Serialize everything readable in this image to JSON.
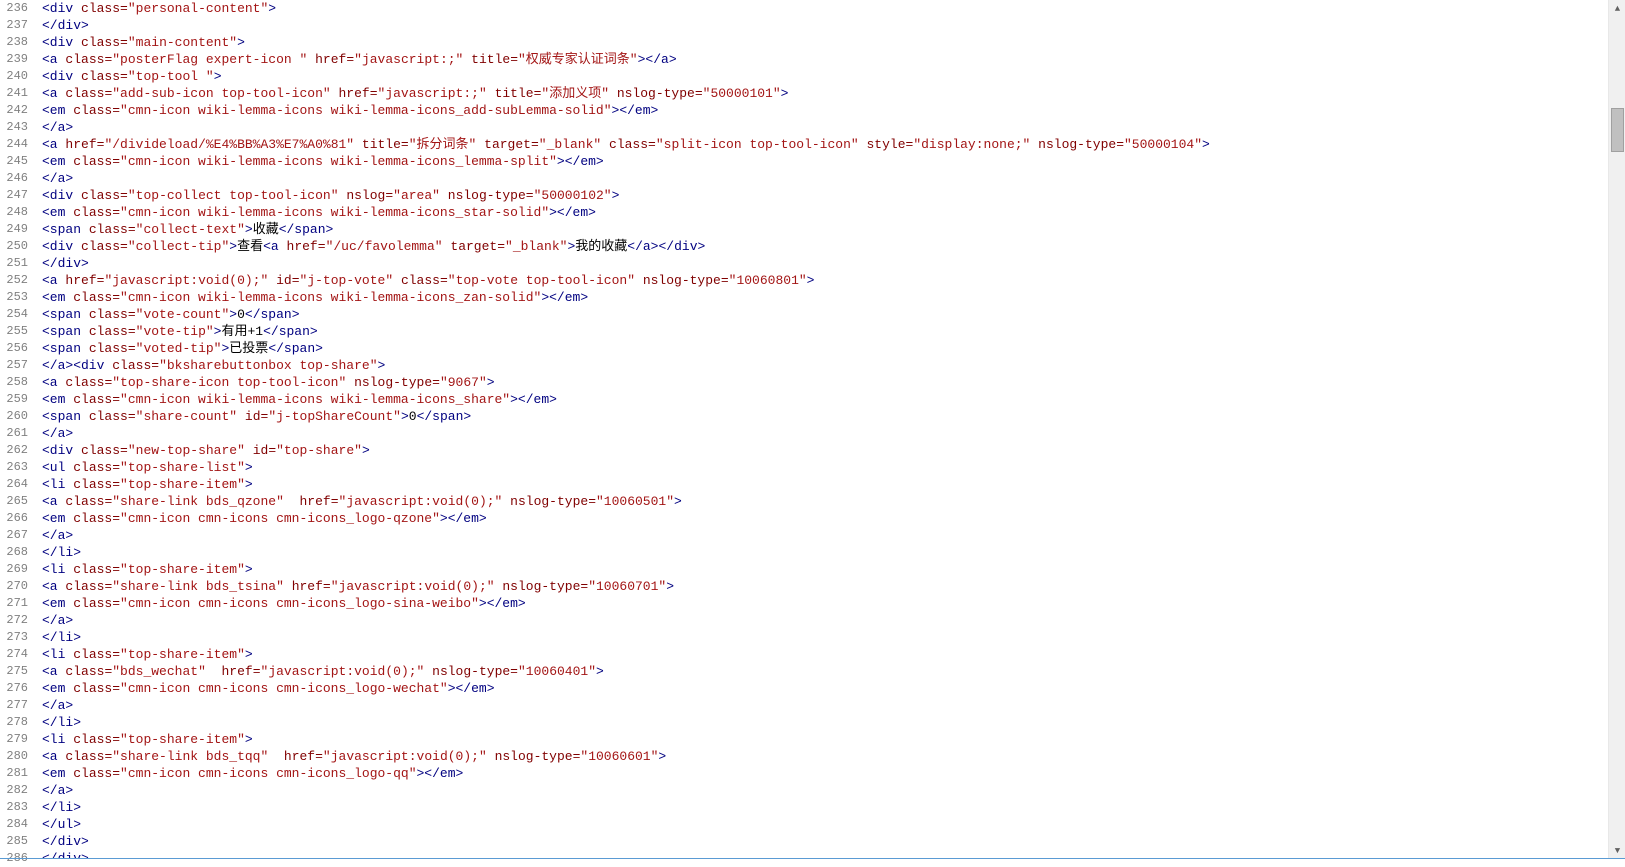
{
  "startLine": 236,
  "lines": [
    [
      [
        "tag",
        "<div"
      ],
      [
        "text",
        " "
      ],
      [
        "attr",
        "class"
      ],
      [
        "punct",
        "="
      ],
      [
        "val",
        "\"personal-content\""
      ],
      [
        "tag",
        ">"
      ]
    ],
    [
      [
        "tag",
        "</div>"
      ]
    ],
    [
      [
        "tag",
        "<div"
      ],
      [
        "text",
        " "
      ],
      [
        "attr",
        "class"
      ],
      [
        "punct",
        "="
      ],
      [
        "val",
        "\"main-content\""
      ],
      [
        "tag",
        ">"
      ]
    ],
    [
      [
        "tag",
        "<a"
      ],
      [
        "text",
        " "
      ],
      [
        "attr",
        "class"
      ],
      [
        "punct",
        "="
      ],
      [
        "val",
        "\"posterFlag expert-icon \""
      ],
      [
        "text",
        " "
      ],
      [
        "attr",
        "href"
      ],
      [
        "punct",
        "="
      ],
      [
        "val",
        "\"javascript:;\""
      ],
      [
        "text",
        " "
      ],
      [
        "attr",
        "title"
      ],
      [
        "punct",
        "="
      ],
      [
        "val",
        "\"权威专家认证词条\""
      ],
      [
        "tag",
        "></a>"
      ]
    ],
    [
      [
        "tag",
        "<div"
      ],
      [
        "text",
        " "
      ],
      [
        "attr",
        "class"
      ],
      [
        "punct",
        "="
      ],
      [
        "val",
        "\"top-tool \""
      ],
      [
        "tag",
        ">"
      ]
    ],
    [
      [
        "tag",
        "<a"
      ],
      [
        "text",
        " "
      ],
      [
        "attr",
        "class"
      ],
      [
        "punct",
        "="
      ],
      [
        "val",
        "\"add-sub-icon top-tool-icon\""
      ],
      [
        "text",
        " "
      ],
      [
        "attr",
        "href"
      ],
      [
        "punct",
        "="
      ],
      [
        "val",
        "\"javascript:;\""
      ],
      [
        "text",
        " "
      ],
      [
        "attr",
        "title"
      ],
      [
        "punct",
        "="
      ],
      [
        "val",
        "\"添加义项\""
      ],
      [
        "text",
        " "
      ],
      [
        "attr",
        "nslog-type"
      ],
      [
        "punct",
        "="
      ],
      [
        "val",
        "\"50000101\""
      ],
      [
        "tag",
        ">"
      ]
    ],
    [
      [
        "tag",
        "<em"
      ],
      [
        "text",
        " "
      ],
      [
        "attr",
        "class"
      ],
      [
        "punct",
        "="
      ],
      [
        "val",
        "\"cmn-icon wiki-lemma-icons wiki-lemma-icons_add-subLemma-solid\""
      ],
      [
        "tag",
        "></em>"
      ]
    ],
    [
      [
        "tag",
        "</a>"
      ]
    ],
    [
      [
        "tag",
        "<a"
      ],
      [
        "text",
        " "
      ],
      [
        "attr",
        "href"
      ],
      [
        "punct",
        "="
      ],
      [
        "val",
        "\"/divideload/%E4%BB%A3%E7%A0%81\""
      ],
      [
        "text",
        " "
      ],
      [
        "attr",
        "title"
      ],
      [
        "punct",
        "="
      ],
      [
        "val",
        "\"拆分词条\""
      ],
      [
        "text",
        " "
      ],
      [
        "attr",
        "target"
      ],
      [
        "punct",
        "="
      ],
      [
        "val",
        "\"_blank\""
      ],
      [
        "text",
        " "
      ],
      [
        "attr",
        "class"
      ],
      [
        "punct",
        "="
      ],
      [
        "val",
        "\"split-icon top-tool-icon\""
      ],
      [
        "text",
        " "
      ],
      [
        "attr",
        "style"
      ],
      [
        "punct",
        "="
      ],
      [
        "val",
        "\"display:none;\""
      ],
      [
        "text",
        " "
      ],
      [
        "attr",
        "nslog-type"
      ],
      [
        "punct",
        "="
      ],
      [
        "val",
        "\"50000104\""
      ],
      [
        "tag",
        ">"
      ]
    ],
    [
      [
        "tag",
        "<em"
      ],
      [
        "text",
        " "
      ],
      [
        "attr",
        "class"
      ],
      [
        "punct",
        "="
      ],
      [
        "val",
        "\"cmn-icon wiki-lemma-icons wiki-lemma-icons_lemma-split\""
      ],
      [
        "tag",
        "></em>"
      ]
    ],
    [
      [
        "tag",
        "</a>"
      ]
    ],
    [
      [
        "tag",
        "<div"
      ],
      [
        "text",
        " "
      ],
      [
        "attr",
        "class"
      ],
      [
        "punct",
        "="
      ],
      [
        "val",
        "\"top-collect top-tool-icon\""
      ],
      [
        "text",
        " "
      ],
      [
        "attr",
        "nslog"
      ],
      [
        "punct",
        "="
      ],
      [
        "val",
        "\"area\""
      ],
      [
        "text",
        " "
      ],
      [
        "attr",
        "nslog-type"
      ],
      [
        "punct",
        "="
      ],
      [
        "val",
        "\"50000102\""
      ],
      [
        "tag",
        ">"
      ]
    ],
    [
      [
        "tag",
        "<em"
      ],
      [
        "text",
        " "
      ],
      [
        "attr",
        "class"
      ],
      [
        "punct",
        "="
      ],
      [
        "val",
        "\"cmn-icon wiki-lemma-icons wiki-lemma-icons_star-solid\""
      ],
      [
        "tag",
        "></em>"
      ]
    ],
    [
      [
        "tag",
        "<span"
      ],
      [
        "text",
        " "
      ],
      [
        "attr",
        "class"
      ],
      [
        "punct",
        "="
      ],
      [
        "val",
        "\"collect-text\""
      ],
      [
        "tag",
        ">"
      ],
      [
        "text",
        "收藏"
      ],
      [
        "tag",
        "</span>"
      ]
    ],
    [
      [
        "tag",
        "<div"
      ],
      [
        "text",
        " "
      ],
      [
        "attr",
        "class"
      ],
      [
        "punct",
        "="
      ],
      [
        "val",
        "\"collect-tip\""
      ],
      [
        "tag",
        ">"
      ],
      [
        "text",
        "查看"
      ],
      [
        "tag",
        "<a"
      ],
      [
        "text",
        " "
      ],
      [
        "attr",
        "href"
      ],
      [
        "punct",
        "="
      ],
      [
        "val",
        "\"/uc/favolemma\""
      ],
      [
        "text",
        " "
      ],
      [
        "attr",
        "target"
      ],
      [
        "punct",
        "="
      ],
      [
        "val",
        "\"_blank\""
      ],
      [
        "tag",
        ">"
      ],
      [
        "text",
        "我的收藏"
      ],
      [
        "tag",
        "</a></div>"
      ]
    ],
    [
      [
        "tag",
        "</div>"
      ]
    ],
    [
      [
        "tag",
        "<a"
      ],
      [
        "text",
        " "
      ],
      [
        "attr",
        "href"
      ],
      [
        "punct",
        "="
      ],
      [
        "val",
        "\"javascript:void(0);\""
      ],
      [
        "text",
        " "
      ],
      [
        "attr",
        "id"
      ],
      [
        "punct",
        "="
      ],
      [
        "val",
        "\"j-top-vote\""
      ],
      [
        "text",
        " "
      ],
      [
        "attr",
        "class"
      ],
      [
        "punct",
        "="
      ],
      [
        "val",
        "\"top-vote top-tool-icon\""
      ],
      [
        "text",
        " "
      ],
      [
        "attr",
        "nslog-type"
      ],
      [
        "punct",
        "="
      ],
      [
        "val",
        "\"10060801\""
      ],
      [
        "tag",
        ">"
      ]
    ],
    [
      [
        "tag",
        "<em"
      ],
      [
        "text",
        " "
      ],
      [
        "attr",
        "class"
      ],
      [
        "punct",
        "="
      ],
      [
        "val",
        "\"cmn-icon wiki-lemma-icons wiki-lemma-icons_zan-solid\""
      ],
      [
        "tag",
        "></em>"
      ]
    ],
    [
      [
        "tag",
        "<span"
      ],
      [
        "text",
        " "
      ],
      [
        "attr",
        "class"
      ],
      [
        "punct",
        "="
      ],
      [
        "val",
        "\"vote-count\""
      ],
      [
        "tag",
        ">"
      ],
      [
        "text",
        "0"
      ],
      [
        "tag",
        "</span>"
      ]
    ],
    [
      [
        "tag",
        "<span"
      ],
      [
        "text",
        " "
      ],
      [
        "attr",
        "class"
      ],
      [
        "punct",
        "="
      ],
      [
        "val",
        "\"vote-tip\""
      ],
      [
        "tag",
        ">"
      ],
      [
        "text",
        "有用+1"
      ],
      [
        "tag",
        "</span>"
      ]
    ],
    [
      [
        "tag",
        "<span"
      ],
      [
        "text",
        " "
      ],
      [
        "attr",
        "class"
      ],
      [
        "punct",
        "="
      ],
      [
        "val",
        "\"voted-tip\""
      ],
      [
        "tag",
        ">"
      ],
      [
        "text",
        "已投票"
      ],
      [
        "tag",
        "</span>"
      ]
    ],
    [
      [
        "tag",
        "</a><div"
      ],
      [
        "text",
        " "
      ],
      [
        "attr",
        "class"
      ],
      [
        "punct",
        "="
      ],
      [
        "val",
        "\"bksharebuttonbox top-share\""
      ],
      [
        "tag",
        ">"
      ]
    ],
    [
      [
        "tag",
        "<a"
      ],
      [
        "text",
        " "
      ],
      [
        "attr",
        "class"
      ],
      [
        "punct",
        "="
      ],
      [
        "val",
        "\"top-share-icon top-tool-icon\""
      ],
      [
        "text",
        " "
      ],
      [
        "attr",
        "nslog-type"
      ],
      [
        "punct",
        "="
      ],
      [
        "val",
        "\"9067\""
      ],
      [
        "tag",
        ">"
      ]
    ],
    [
      [
        "tag",
        "<em"
      ],
      [
        "text",
        " "
      ],
      [
        "attr",
        "class"
      ],
      [
        "punct",
        "="
      ],
      [
        "val",
        "\"cmn-icon wiki-lemma-icons wiki-lemma-icons_share\""
      ],
      [
        "tag",
        "></em>"
      ]
    ],
    [
      [
        "tag",
        "<span"
      ],
      [
        "text",
        " "
      ],
      [
        "attr",
        "class"
      ],
      [
        "punct",
        "="
      ],
      [
        "val",
        "\"share-count\""
      ],
      [
        "text",
        " "
      ],
      [
        "attr",
        "id"
      ],
      [
        "punct",
        "="
      ],
      [
        "val",
        "\"j-topShareCount\""
      ],
      [
        "tag",
        ">"
      ],
      [
        "text",
        "0"
      ],
      [
        "tag",
        "</span>"
      ]
    ],
    [
      [
        "tag",
        "</a>"
      ]
    ],
    [
      [
        "tag",
        "<div"
      ],
      [
        "text",
        " "
      ],
      [
        "attr",
        "class"
      ],
      [
        "punct",
        "="
      ],
      [
        "val",
        "\"new-top-share\""
      ],
      [
        "text",
        " "
      ],
      [
        "attr",
        "id"
      ],
      [
        "punct",
        "="
      ],
      [
        "val",
        "\"top-share\""
      ],
      [
        "tag",
        ">"
      ]
    ],
    [
      [
        "tag",
        "<ul"
      ],
      [
        "text",
        " "
      ],
      [
        "attr",
        "class"
      ],
      [
        "punct",
        "="
      ],
      [
        "val",
        "\"top-share-list\""
      ],
      [
        "tag",
        ">"
      ]
    ],
    [
      [
        "tag",
        "<li"
      ],
      [
        "text",
        " "
      ],
      [
        "attr",
        "class"
      ],
      [
        "punct",
        "="
      ],
      [
        "val",
        "\"top-share-item\""
      ],
      [
        "tag",
        ">"
      ]
    ],
    [
      [
        "tag",
        "<a"
      ],
      [
        "text",
        " "
      ],
      [
        "attr",
        "class"
      ],
      [
        "punct",
        "="
      ],
      [
        "val",
        "\"share-link bds_qzone\""
      ],
      [
        "text",
        "  "
      ],
      [
        "attr",
        "href"
      ],
      [
        "punct",
        "="
      ],
      [
        "val",
        "\"javascript:void(0);\""
      ],
      [
        "text",
        " "
      ],
      [
        "attr",
        "nslog-type"
      ],
      [
        "punct",
        "="
      ],
      [
        "val",
        "\"10060501\""
      ],
      [
        "tag",
        ">"
      ]
    ],
    [
      [
        "tag",
        "<em"
      ],
      [
        "text",
        " "
      ],
      [
        "attr",
        "class"
      ],
      [
        "punct",
        "="
      ],
      [
        "val",
        "\"cmn-icon cmn-icons cmn-icons_logo-qzone\""
      ],
      [
        "tag",
        "></em>"
      ]
    ],
    [
      [
        "tag",
        "</a>"
      ]
    ],
    [
      [
        "tag",
        "</li>"
      ]
    ],
    [
      [
        "tag",
        "<li"
      ],
      [
        "text",
        " "
      ],
      [
        "attr",
        "class"
      ],
      [
        "punct",
        "="
      ],
      [
        "val",
        "\"top-share-item\""
      ],
      [
        "tag",
        ">"
      ]
    ],
    [
      [
        "tag",
        "<a"
      ],
      [
        "text",
        " "
      ],
      [
        "attr",
        "class"
      ],
      [
        "punct",
        "="
      ],
      [
        "val",
        "\"share-link bds_tsina\""
      ],
      [
        "text",
        " "
      ],
      [
        "attr",
        "href"
      ],
      [
        "punct",
        "="
      ],
      [
        "val",
        "\"javascript:void(0);\""
      ],
      [
        "text",
        " "
      ],
      [
        "attr",
        "nslog-type"
      ],
      [
        "punct",
        "="
      ],
      [
        "val",
        "\"10060701\""
      ],
      [
        "tag",
        ">"
      ]
    ],
    [
      [
        "tag",
        "<em"
      ],
      [
        "text",
        " "
      ],
      [
        "attr",
        "class"
      ],
      [
        "punct",
        "="
      ],
      [
        "val",
        "\"cmn-icon cmn-icons cmn-icons_logo-sina-weibo\""
      ],
      [
        "tag",
        "></em>"
      ]
    ],
    [
      [
        "tag",
        "</a>"
      ]
    ],
    [
      [
        "tag",
        "</li>"
      ]
    ],
    [
      [
        "tag",
        "<li"
      ],
      [
        "text",
        " "
      ],
      [
        "attr",
        "class"
      ],
      [
        "punct",
        "="
      ],
      [
        "val",
        "\"top-share-item\""
      ],
      [
        "tag",
        ">"
      ]
    ],
    [
      [
        "tag",
        "<a"
      ],
      [
        "text",
        " "
      ],
      [
        "attr",
        "class"
      ],
      [
        "punct",
        "="
      ],
      [
        "val",
        "\"bds_wechat\""
      ],
      [
        "text",
        "  "
      ],
      [
        "attr",
        "href"
      ],
      [
        "punct",
        "="
      ],
      [
        "val",
        "\"javascript:void(0);\""
      ],
      [
        "text",
        " "
      ],
      [
        "attr",
        "nslog-type"
      ],
      [
        "punct",
        "="
      ],
      [
        "val",
        "\"10060401\""
      ],
      [
        "tag",
        ">"
      ]
    ],
    [
      [
        "tag",
        "<em"
      ],
      [
        "text",
        " "
      ],
      [
        "attr",
        "class"
      ],
      [
        "punct",
        "="
      ],
      [
        "val",
        "\"cmn-icon cmn-icons cmn-icons_logo-wechat\""
      ],
      [
        "tag",
        "></em>"
      ]
    ],
    [
      [
        "tag",
        "</a>"
      ]
    ],
    [
      [
        "tag",
        "</li>"
      ]
    ],
    [
      [
        "tag",
        "<li"
      ],
      [
        "text",
        " "
      ],
      [
        "attr",
        "class"
      ],
      [
        "punct",
        "="
      ],
      [
        "val",
        "\"top-share-item\""
      ],
      [
        "tag",
        ">"
      ]
    ],
    [
      [
        "tag",
        "<a"
      ],
      [
        "text",
        " "
      ],
      [
        "attr",
        "class"
      ],
      [
        "punct",
        "="
      ],
      [
        "val",
        "\"share-link bds_tqq\""
      ],
      [
        "text",
        "  "
      ],
      [
        "attr",
        "href"
      ],
      [
        "punct",
        "="
      ],
      [
        "val",
        "\"javascript:void(0);\""
      ],
      [
        "text",
        " "
      ],
      [
        "attr",
        "nslog-type"
      ],
      [
        "punct",
        "="
      ],
      [
        "val",
        "\"10060601\""
      ],
      [
        "tag",
        ">"
      ]
    ],
    [
      [
        "tag",
        "<em"
      ],
      [
        "text",
        " "
      ],
      [
        "attr",
        "class"
      ],
      [
        "punct",
        "="
      ],
      [
        "val",
        "\"cmn-icon cmn-icons cmn-icons_logo-qq\""
      ],
      [
        "tag",
        "></em>"
      ]
    ],
    [
      [
        "tag",
        "</a>"
      ]
    ],
    [
      [
        "tag",
        "</li>"
      ]
    ],
    [
      [
        "tag",
        "</ul>"
      ]
    ],
    [
      [
        "tag",
        "</div>"
      ]
    ],
    [
      [
        "tag",
        "</div>"
      ]
    ]
  ],
  "scroll": {
    "upGlyph": "▲",
    "downGlyph": "▼",
    "thumbTop": 108,
    "thumbHeight": 44
  }
}
